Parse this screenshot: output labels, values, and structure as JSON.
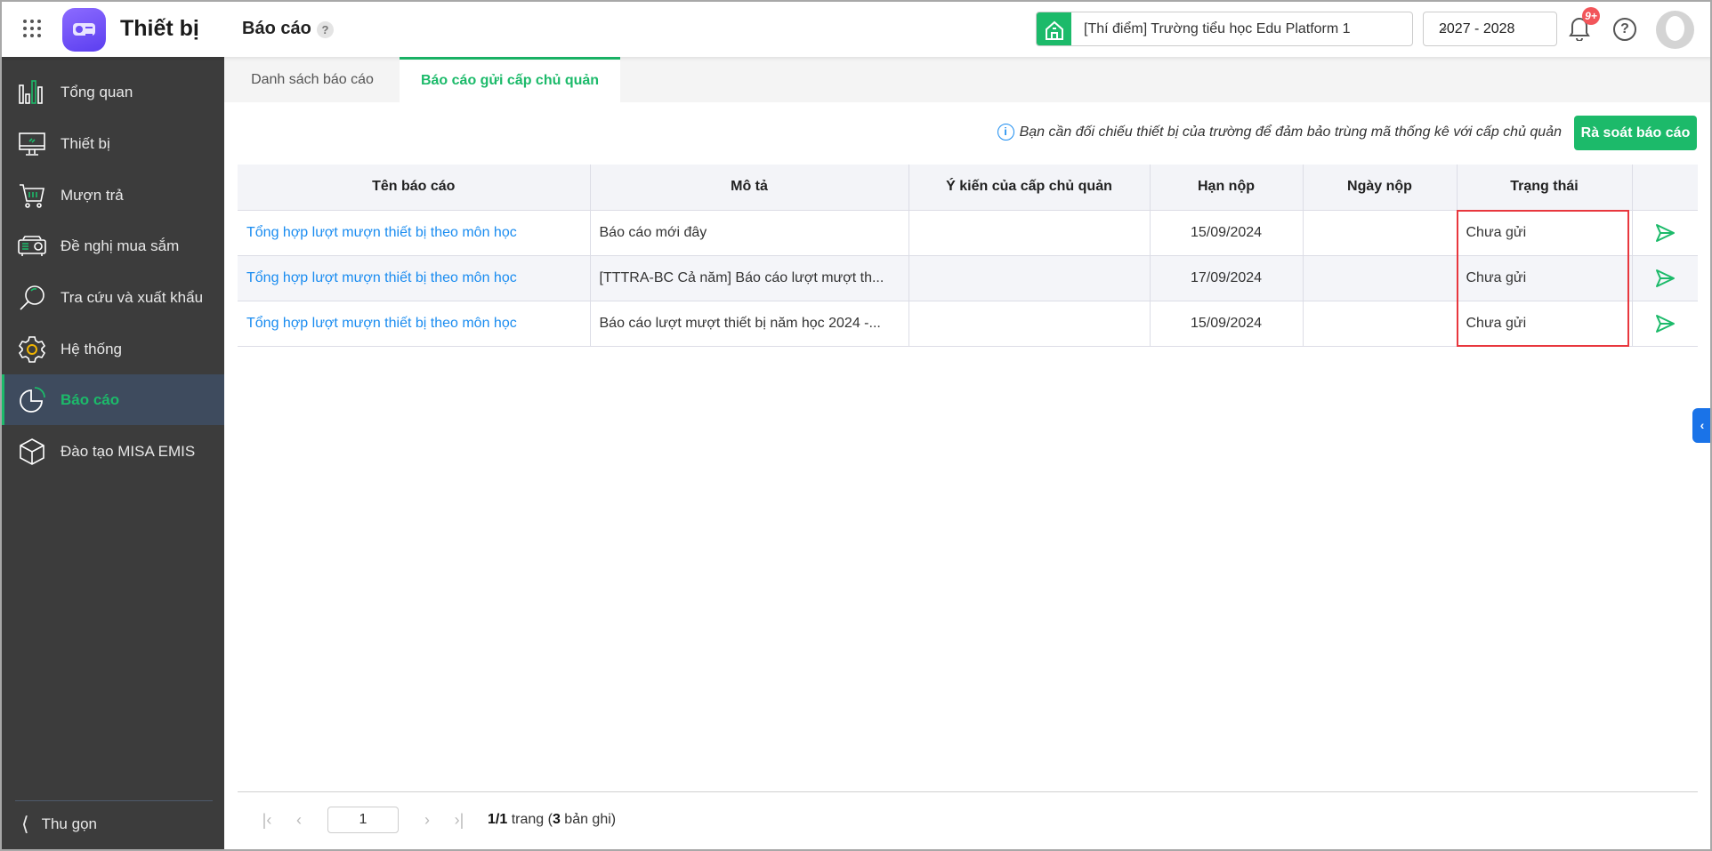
{
  "header": {
    "app_title": "Thiết bị",
    "page_title": "Báo cáo",
    "help_badge": "?",
    "school": "[Thí điểm] Trường tiểu học Edu Platform 1",
    "year": "2027 - 2028",
    "notif_count": "9+",
    "help": "?"
  },
  "sidebar": {
    "items": [
      {
        "label": "Tổng quan",
        "icon": "bar-chart-icon"
      },
      {
        "label": "Thiết bị",
        "icon": "monitor-icon"
      },
      {
        "label": "Mượn trả",
        "icon": "cart-icon"
      },
      {
        "label": "Đề nghị mua sắm",
        "icon": "projector-icon"
      },
      {
        "label": "Tra cứu và xuất khẩu",
        "icon": "search-icon"
      },
      {
        "label": "Hệ thống",
        "icon": "gear-icon"
      },
      {
        "label": "Báo cáo",
        "icon": "pie-chart-icon",
        "active": true
      },
      {
        "label": "Đào tạo MISA EMIS",
        "icon": "cube-icon"
      }
    ],
    "collapse": "Thu gọn"
  },
  "tabs": [
    {
      "label": "Danh sách báo cáo"
    },
    {
      "label": "Báo cáo gửi cấp chủ quản",
      "active": true
    }
  ],
  "info_text": "Bạn cần đối chiếu thiết bị của trường để đảm bảo trùng mã thống kê với cấp chủ quản",
  "review_button": "Rà soát báo cáo",
  "table": {
    "headers": [
      "Tên báo cáo",
      "Mô tả",
      "Ý kiến của cấp chủ quản",
      "Hạn nộp",
      "Ngày nộp",
      "Trạng thái",
      ""
    ],
    "rows": [
      {
        "name": "Tổng hợp lượt mượn thiết bị theo môn học",
        "desc": "Báo cáo mới đây",
        "opinion": "",
        "deadline": "15/09/2024",
        "submitted": "",
        "status": "Chưa gửi"
      },
      {
        "name": "Tổng hợp lượt mượn thiết bị theo môn học",
        "desc": "[TTTRA-BC Cả năm] Báo cáo lượt mượt th...",
        "opinion": "",
        "deadline": "17/09/2024",
        "submitted": "",
        "status": "Chưa gửi"
      },
      {
        "name": "Tổng hợp lượt mượn thiết bị theo môn học",
        "desc": "Báo cáo lượt mượt thiết bị năm học 2024 -...",
        "opinion": "",
        "deadline": "15/09/2024",
        "submitted": "",
        "status": "Chưa gửi"
      }
    ]
  },
  "pagination": {
    "page": "1",
    "page_of": "1/1",
    "page_word": " trang (",
    "records": "3",
    "records_word": " bản ghi)"
  },
  "colors": {
    "accent": "#1cba6a",
    "link": "#1a8cf0",
    "sidebar": "#3c3c3c",
    "highlight": "#e8373e"
  }
}
